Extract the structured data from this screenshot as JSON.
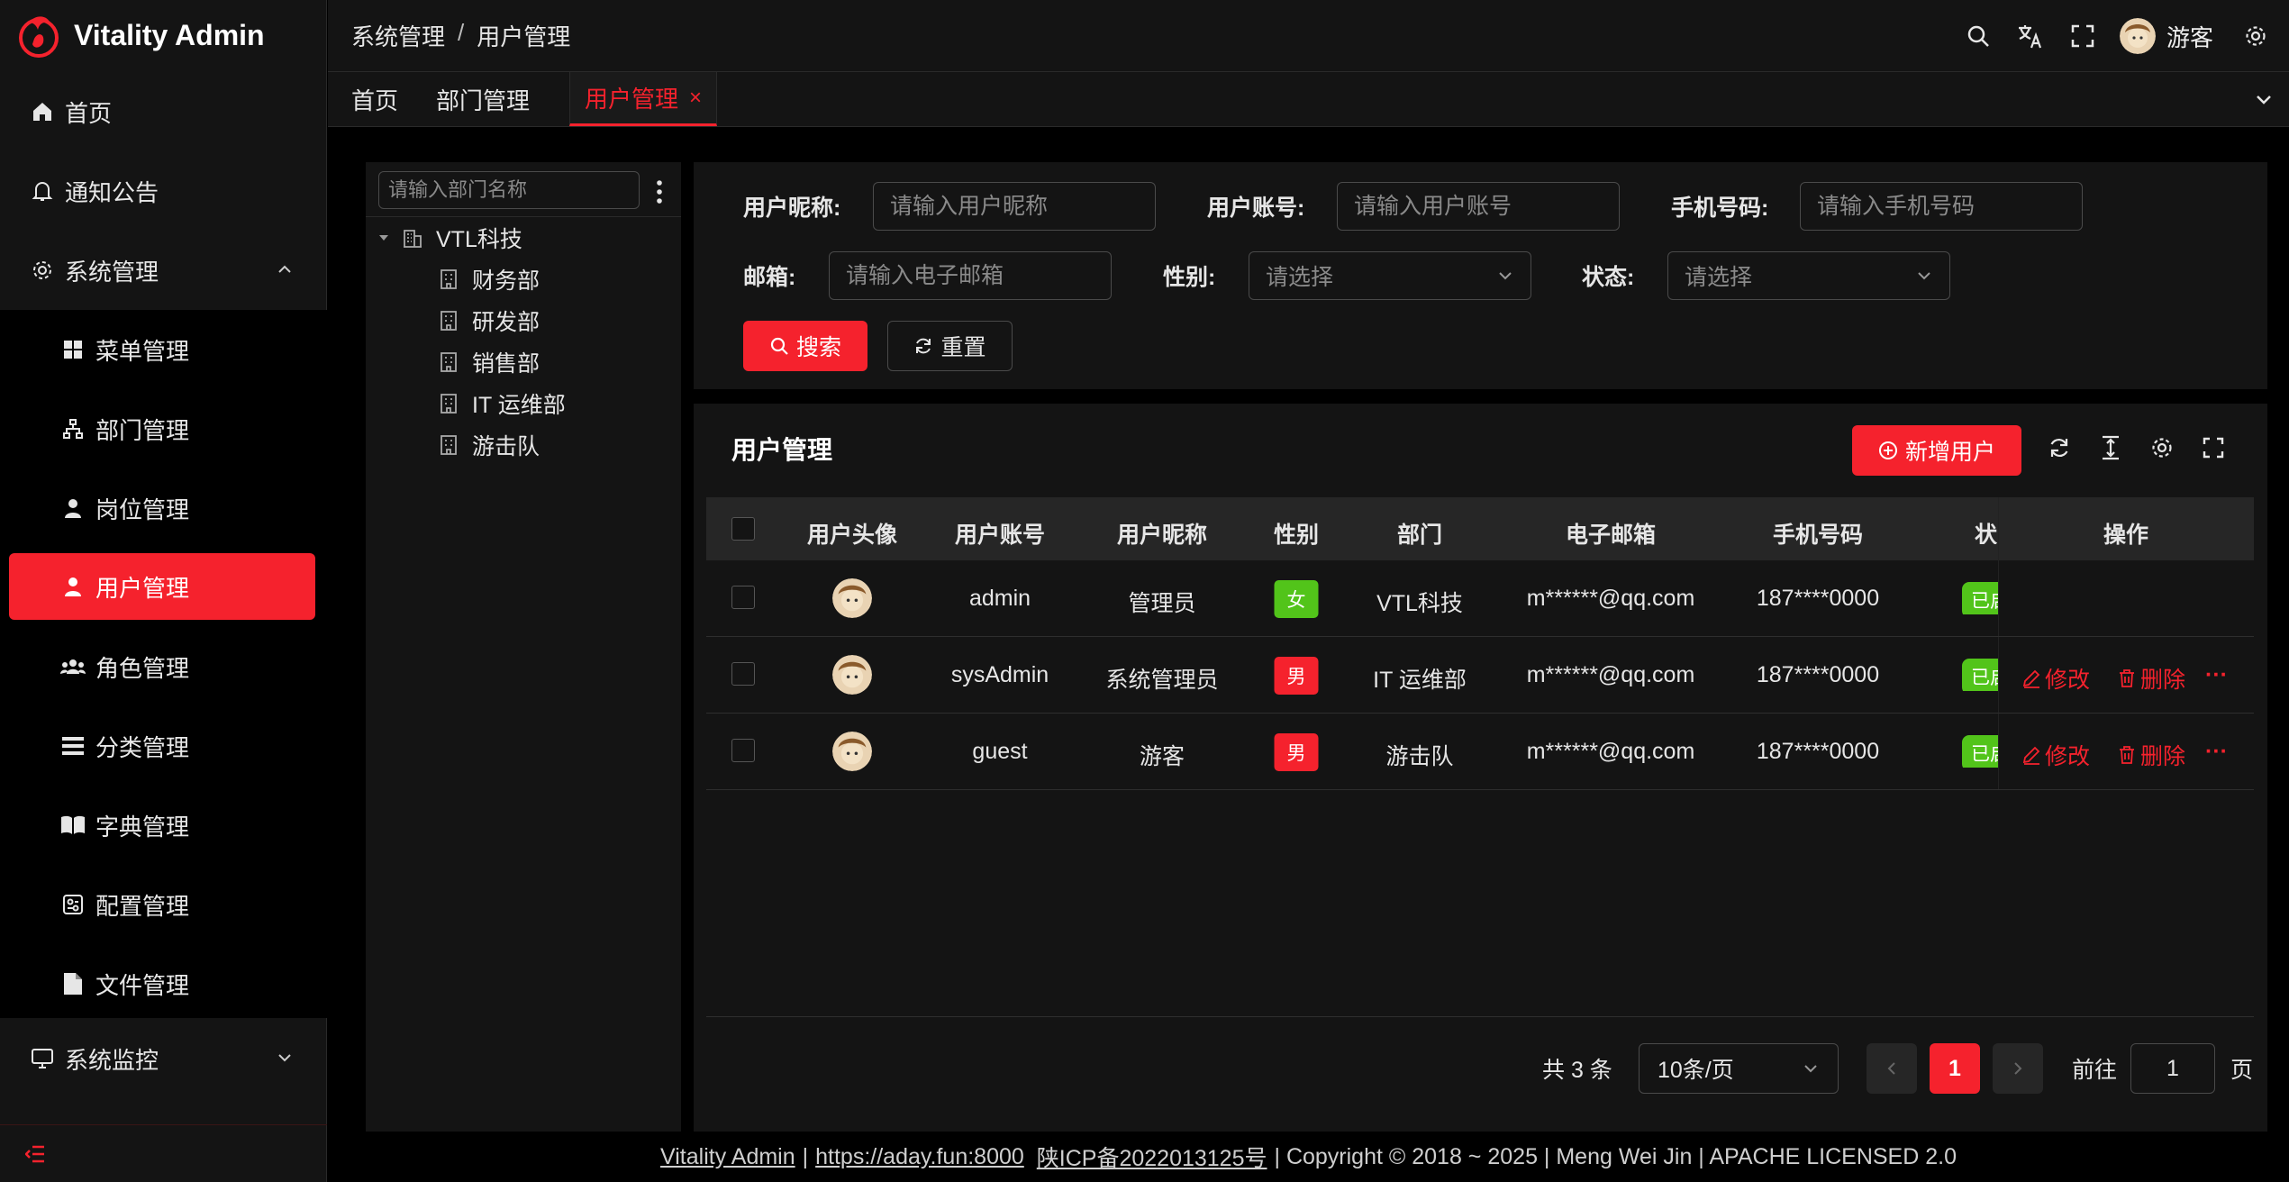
{
  "app": {
    "title": "Vitality Admin"
  },
  "sidebar": {
    "items": [
      {
        "label": "首页",
        "icon": "home-icon"
      },
      {
        "label": "通知公告",
        "icon": "bell-icon"
      },
      {
        "label": "系统管理",
        "icon": "gear-icon",
        "expanded": true
      },
      {
        "label": "系统监控",
        "icon": "monitor-icon",
        "expanded": false
      }
    ],
    "submenu": [
      {
        "label": "菜单管理",
        "icon": "grid-icon"
      },
      {
        "label": "部门管理",
        "icon": "org-icon"
      },
      {
        "label": "岗位管理",
        "icon": "person-tie-icon"
      },
      {
        "label": "用户管理",
        "icon": "user-icon",
        "active": true
      },
      {
        "label": "角色管理",
        "icon": "group-icon"
      },
      {
        "label": "分类管理",
        "icon": "list-icon"
      },
      {
        "label": "字典管理",
        "icon": "book-icon"
      },
      {
        "label": "配置管理",
        "icon": "config-icon"
      },
      {
        "label": "文件管理",
        "icon": "file-icon"
      }
    ]
  },
  "header": {
    "breadcrumb": [
      "系统管理",
      "用户管理"
    ],
    "separator": "/",
    "user": "游客"
  },
  "tabs": [
    {
      "label": "首页"
    },
    {
      "label": "部门管理"
    },
    {
      "label": "用户管理",
      "active": true,
      "close": "×"
    }
  ],
  "dept": {
    "search_placeholder": "请输入部门名称",
    "root": "VTL科技",
    "children": [
      "财务部",
      "研发部",
      "销售部",
      "IT 运维部",
      "游击队"
    ]
  },
  "filters": {
    "nickname": {
      "label": "用户昵称:",
      "placeholder": "请输入用户昵称"
    },
    "account": {
      "label": "用户账号:",
      "placeholder": "请输入用户账号"
    },
    "phone": {
      "label": "手机号码:",
      "placeholder": "请输入手机号码"
    },
    "email": {
      "label": "邮箱:",
      "placeholder": "请输入电子邮箱"
    },
    "gender": {
      "label": "性别:",
      "placeholder": "请选择"
    },
    "status": {
      "label": "状态:",
      "placeholder": "请选择"
    },
    "search_button": "搜索",
    "reset_button": "重置"
  },
  "table": {
    "title": "用户管理",
    "add_button": "新增用户",
    "columns": {
      "avatar": "用户头像",
      "account": "用户账号",
      "nickname": "用户昵称",
      "gender": "性别",
      "dept": "部门",
      "email": "电子邮箱",
      "phone": "手机号码",
      "status": "状",
      "actions": "操作"
    },
    "rows": [
      {
        "account": "admin",
        "nickname": "管理员",
        "gender": "女",
        "dept": "VTL科技",
        "email": "m******@qq.com",
        "phone": "187****0000",
        "status": "已启用"
      },
      {
        "account": "sysAdmin",
        "nickname": "系统管理员",
        "gender": "男",
        "dept": "IT 运维部",
        "email": "m******@qq.com",
        "phone": "187****0000",
        "status": "已启用"
      },
      {
        "account": "guest",
        "nickname": "游客",
        "gender": "男",
        "dept": "游击队",
        "email": "m******@qq.com",
        "phone": "187****0000",
        "status": "已启用"
      }
    ],
    "edit_label": "修改",
    "delete_label": "删除",
    "more_label": "···"
  },
  "pagination": {
    "total_text": "共 3 条",
    "page_size": "10条/页",
    "current_page": "1",
    "goto_label": "前往",
    "goto_value": "1",
    "page_suffix": "页"
  },
  "footer": {
    "brand": "Vitality Admin",
    "sep": "|",
    "link": "https://aday.fun:8000",
    "icp": "陕ICP备2022013125号",
    "copyright": "| Copyright © 2018 ~ 2025 | Meng Wei Jin | APACHE LICENSED 2.0"
  },
  "colors": {
    "accent": "#f5222d",
    "success": "#52c41a",
    "panel": "#141414",
    "background": "#000000"
  }
}
